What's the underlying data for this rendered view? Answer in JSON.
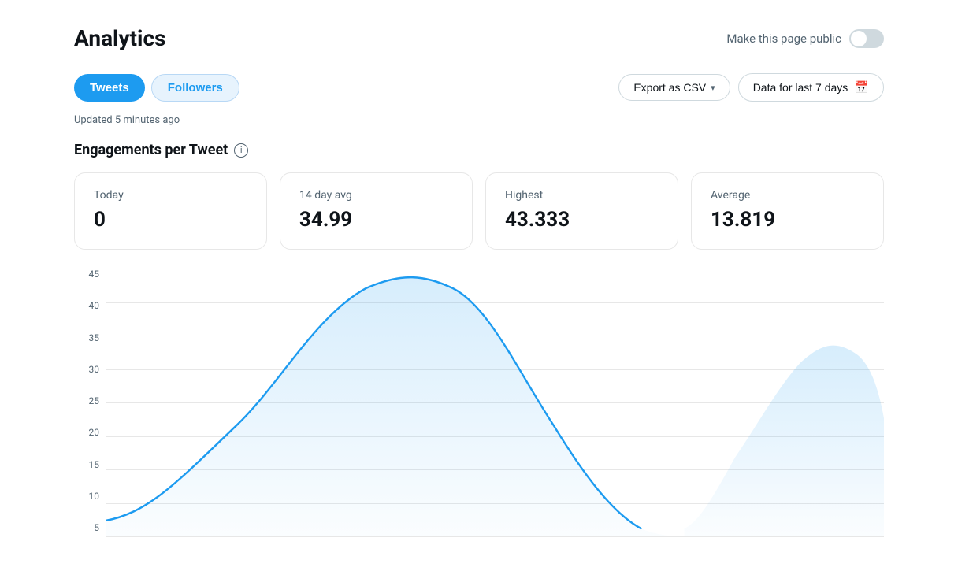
{
  "page": {
    "title": "Analytics",
    "make_public_label": "Make this page public"
  },
  "tabs": [
    {
      "id": "tweets",
      "label": "Tweets",
      "active": true
    },
    {
      "id": "followers",
      "label": "Followers",
      "active": false
    }
  ],
  "toolbar": {
    "export_label": "Export as CSV",
    "date_label": "Data for last 7 days"
  },
  "updated_text": "Updated 5 minutes ago",
  "section": {
    "title": "Engagements per Tweet",
    "info_icon_label": "i"
  },
  "cards": [
    {
      "id": "today",
      "label": "Today",
      "value": "0"
    },
    {
      "id": "14day_avg",
      "label": "14 day avg",
      "value": "34.99"
    },
    {
      "id": "highest",
      "label": "Highest",
      "value": "43.333"
    },
    {
      "id": "average",
      "label": "Average",
      "value": "13.819"
    }
  ],
  "chart": {
    "y_labels": [
      "45",
      "40",
      "35",
      "30",
      "25",
      "20",
      "15",
      "10",
      "5"
    ],
    "accent_color": "#1d9bf0"
  }
}
